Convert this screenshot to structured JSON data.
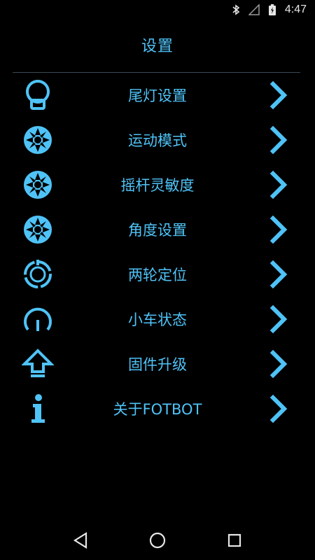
{
  "status_bar": {
    "time": "4:47",
    "icons": [
      "bluetooth-icon",
      "signal-icon",
      "battery-charging-icon"
    ]
  },
  "header": {
    "title": "设置"
  },
  "menu": {
    "items": [
      {
        "label": "尾灯设置",
        "icon": "taillight-icon"
      },
      {
        "label": "运动模式",
        "icon": "wheel-icon"
      },
      {
        "label": "摇杆灵敏度",
        "icon": "wheel-icon"
      },
      {
        "label": "角度设置",
        "icon": "wheel-icon"
      },
      {
        "label": "两轮定位",
        "icon": "calibration-icon"
      },
      {
        "label": "小车状态",
        "icon": "power-icon"
      },
      {
        "label": "固件升级",
        "icon": "upload-arrow-icon"
      },
      {
        "label": "关于FOTBOT",
        "icon": "info-icon"
      }
    ]
  },
  "nav_bar": {
    "buttons": [
      "back-icon",
      "home-icon",
      "recents-icon"
    ]
  },
  "colors": {
    "accent": "#4fc3f7",
    "background": "#000000",
    "divider": "#3a4a55"
  }
}
